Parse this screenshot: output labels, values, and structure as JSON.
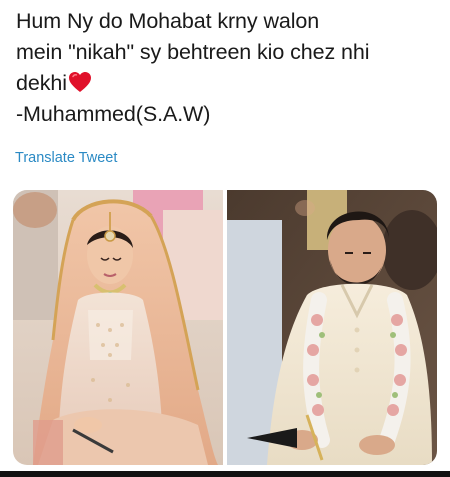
{
  "tweet": {
    "text_lines": [
      "Hum Ny do Mohabat krny walon",
      "mein \"nikah\" sy behtreen kio chez nhi",
      "dekhi",
      "-Muhammed(S.A.W)"
    ],
    "emoji": "red-heart",
    "translate_label": "Translate Tweet"
  },
  "media": {
    "photos": [
      {
        "subject": "bride"
      },
      {
        "subject": "groom"
      }
    ]
  },
  "colors": {
    "text": "#1a1a1a",
    "link": "#2b8ac4",
    "heart": "#e0102a",
    "background": "#ffffff"
  }
}
